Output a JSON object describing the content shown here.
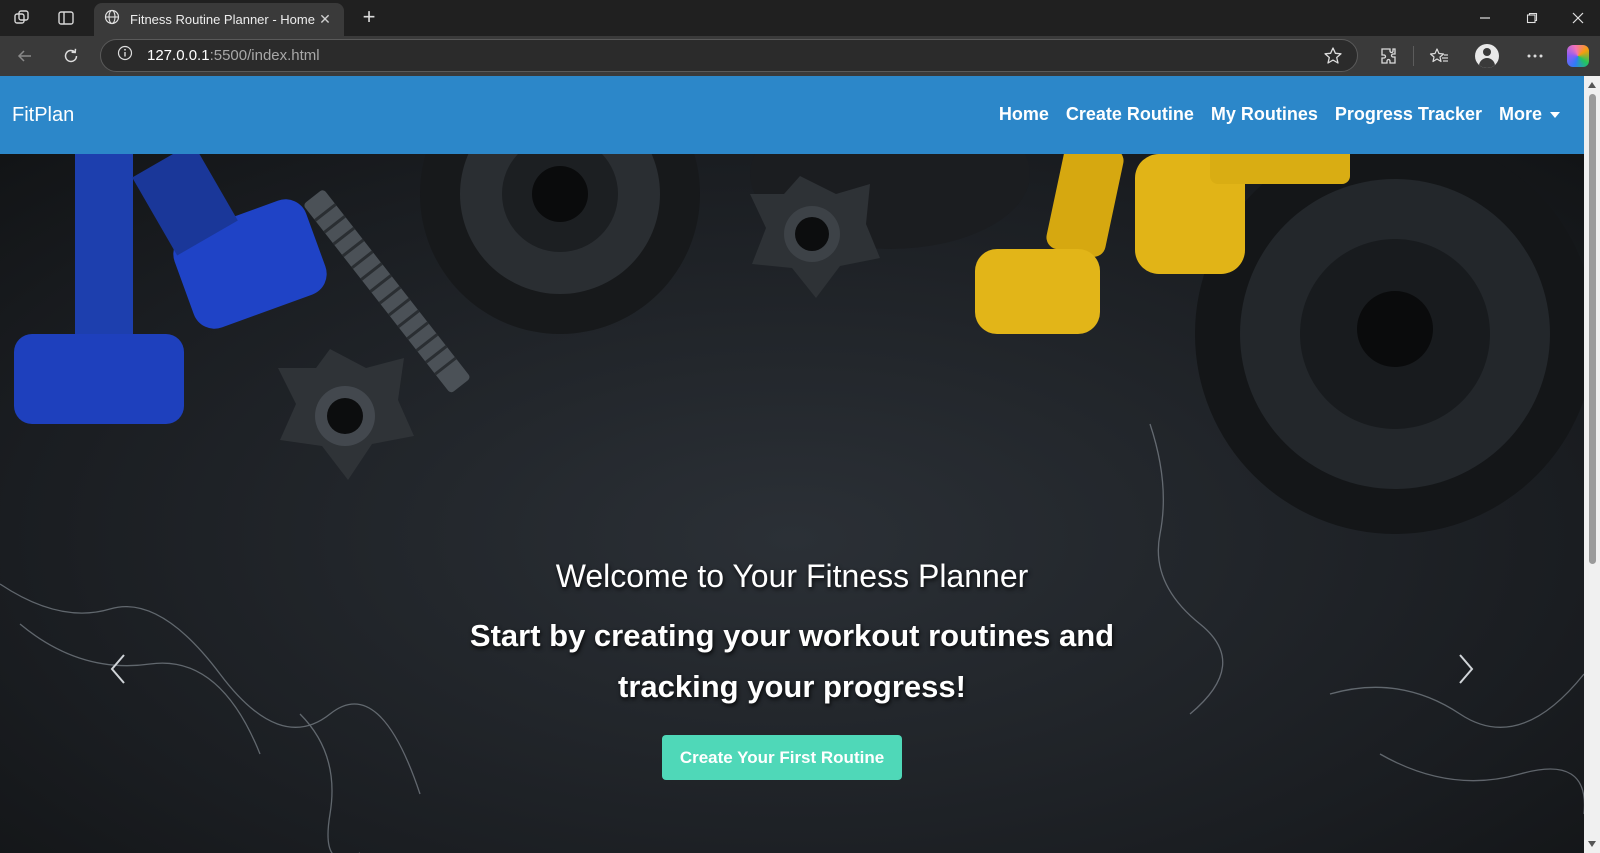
{
  "browser": {
    "tab_title": "Fitness Routine Planner - Home",
    "url_host": "127.0.0.1",
    "url_rest": ":5500/index.html",
    "new_tab_label": "+",
    "close_tab_label": "✕"
  },
  "navbar": {
    "brand": "FitPlan",
    "links": [
      "Home",
      "Create Routine",
      "My Routines",
      "Progress Tracker",
      "More"
    ],
    "background_color": "#2c87c9"
  },
  "hero": {
    "welcome": "Welcome to Your Fitness Planner",
    "subtitle": "Start by creating your workout routines and tracking your progress!",
    "cta_label": "Create Your First Routine",
    "cta_color": "#4fd8b8"
  },
  "icons": [
    "workspaces-icon",
    "tab-actions-icon",
    "globe-icon",
    "back-icon",
    "reload-icon",
    "info-icon",
    "star-icon",
    "extensions-icon",
    "favorites-icon",
    "profile-icon",
    "more-icon",
    "copilot-icon",
    "minimize-icon",
    "restore-icon",
    "close-icon",
    "chevron-left-icon",
    "chevron-right-icon"
  ]
}
